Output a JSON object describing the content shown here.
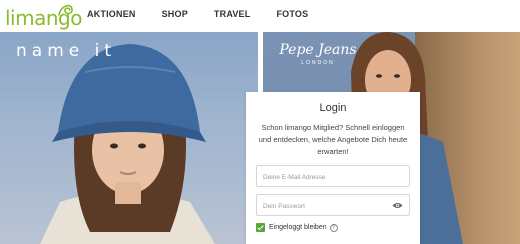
{
  "header": {
    "logo_text": "limango",
    "nav": [
      {
        "label": "AKTIONEN"
      },
      {
        "label": "SHOP"
      },
      {
        "label": "TRAVEL"
      },
      {
        "label": "FOTOS"
      }
    ]
  },
  "hero": {
    "brand_left": "name it",
    "brand_right_line1": "Pepe Jeans",
    "brand_right_line2": "LONDON"
  },
  "login": {
    "title": "Login",
    "description": "Schon limango Mitglied? Schnell einloggen und entdecken, welche Angebote Dich heute erwarten!",
    "email_placeholder": "Deine E-Mail Adresse",
    "password_placeholder": "Dein Passwort",
    "remember_label": "Eingeloggt bleiben",
    "remember_checked": true,
    "help_symbol": "?"
  },
  "colors": {
    "brand_green": "#8cbb2f",
    "checkbox_green": "#5aa43a"
  }
}
